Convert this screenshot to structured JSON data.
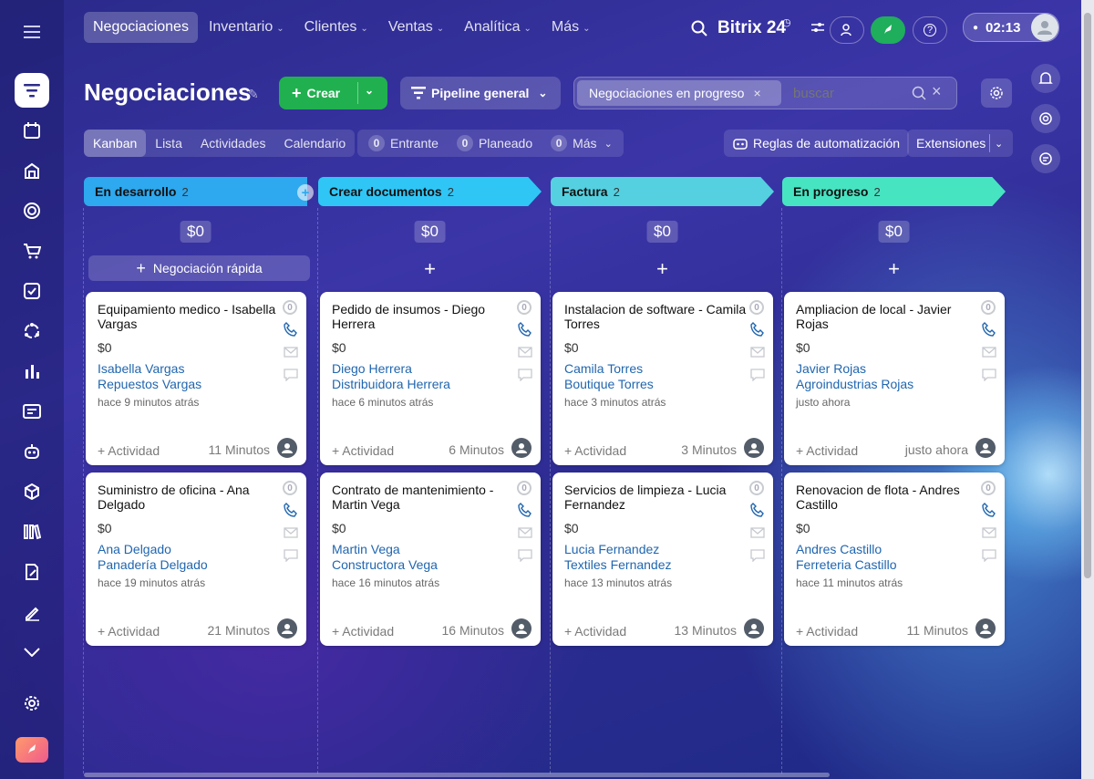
{
  "nav": {
    "items": [
      {
        "label": "Negociaciones",
        "active": true,
        "chev": false
      },
      {
        "label": "Inventario",
        "chev": true
      },
      {
        "label": "Clientes",
        "chev": true
      },
      {
        "label": "Ventas",
        "chev": true
      },
      {
        "label": "Analítica",
        "chev": true
      },
      {
        "label": "Más",
        "chev": true
      }
    ],
    "brand": "Bitrix 24",
    "clock": "02:13"
  },
  "toolbar": {
    "title": "Negociaciones",
    "create_label": "Crear",
    "pipeline_label": "Pipeline general",
    "filter_chip": "Negociaciones en progreso",
    "search_placeholder": "buscar"
  },
  "views": [
    "Kanban",
    "Lista",
    "Actividades",
    "Calendario"
  ],
  "counters": [
    {
      "count": "0",
      "label": "Entrante"
    },
    {
      "count": "0",
      "label": "Planeado"
    },
    {
      "count": "0",
      "label": "Más"
    }
  ],
  "automation_label": "Reglas de automatización",
  "extensions_label": "Extensiones",
  "quick_deal_label": "Negociación rápida",
  "activity_label": "+ Actividad",
  "columns": [
    {
      "title": "En desarrollo",
      "count": "2",
      "sum": "$0",
      "color": "#2ea8ee",
      "cards": [
        {
          "title": "Equipamiento medico - Isabella Vargas",
          "amount": "$0",
          "contact": "Isabella Vargas",
          "company": "Repuestos Vargas",
          "time": "hace 9 minutos atrás",
          "ago": "11 Minutos"
        },
        {
          "title": "Suministro de oficina - Ana Delgado",
          "amount": "$0",
          "contact": "Ana Delgado",
          "company": "Panadería Delgado",
          "time": "hace 19 minutos atrás",
          "ago": "21 Minutos"
        }
      ]
    },
    {
      "title": "Crear documentos",
      "count": "2",
      "sum": "$0",
      "color": "#2fc6f6",
      "cards": [
        {
          "title": "Pedido de insumos - Diego Herrera",
          "amount": "$0",
          "contact": "Diego Herrera",
          "company": "Distribuidora Herrera",
          "time": "hace 6 minutos atrás",
          "ago": "6 Minutos"
        },
        {
          "title": "Contrato de mantenimiento - Martin Vega",
          "amount": "$0",
          "contact": "Martin Vega",
          "company": "Constructora Vega",
          "time": "hace 16 minutos atrás",
          "ago": "16 Minutos"
        }
      ]
    },
    {
      "title": "Factura",
      "count": "2",
      "sum": "$0",
      "color": "#55d0e0",
      "cards": [
        {
          "title": "Instalacion de software - Camila Torres",
          "amount": "$0",
          "contact": "Camila Torres",
          "company": "Boutique Torres",
          "time": "hace 3 minutos atrás",
          "ago": "3 Minutos"
        },
        {
          "title": "Servicios de limpieza - Lucia Fernandez",
          "amount": "$0",
          "contact": "Lucia Fernandez",
          "company": "Textiles Fernandez",
          "time": "hace 13 minutos atrás",
          "ago": "13 Minutos"
        }
      ]
    },
    {
      "title": "En progreso",
      "count": "2",
      "sum": "$0",
      "color": "#47e4c2",
      "cards": [
        {
          "title": "Ampliacion de local - Javier Rojas",
          "amount": "$0",
          "contact": "Javier Rojas",
          "company": "Agroindustrias Rojas",
          "time": "justo ahora",
          "ago": "justo ahora"
        },
        {
          "title": "Renovacion de flota - Andres Castillo",
          "amount": "$0",
          "contact": "Andres Castillo",
          "company": "Ferreteria Castillo",
          "time": "hace 11 minutos atrás",
          "ago": "11 Minutos"
        }
      ]
    }
  ]
}
